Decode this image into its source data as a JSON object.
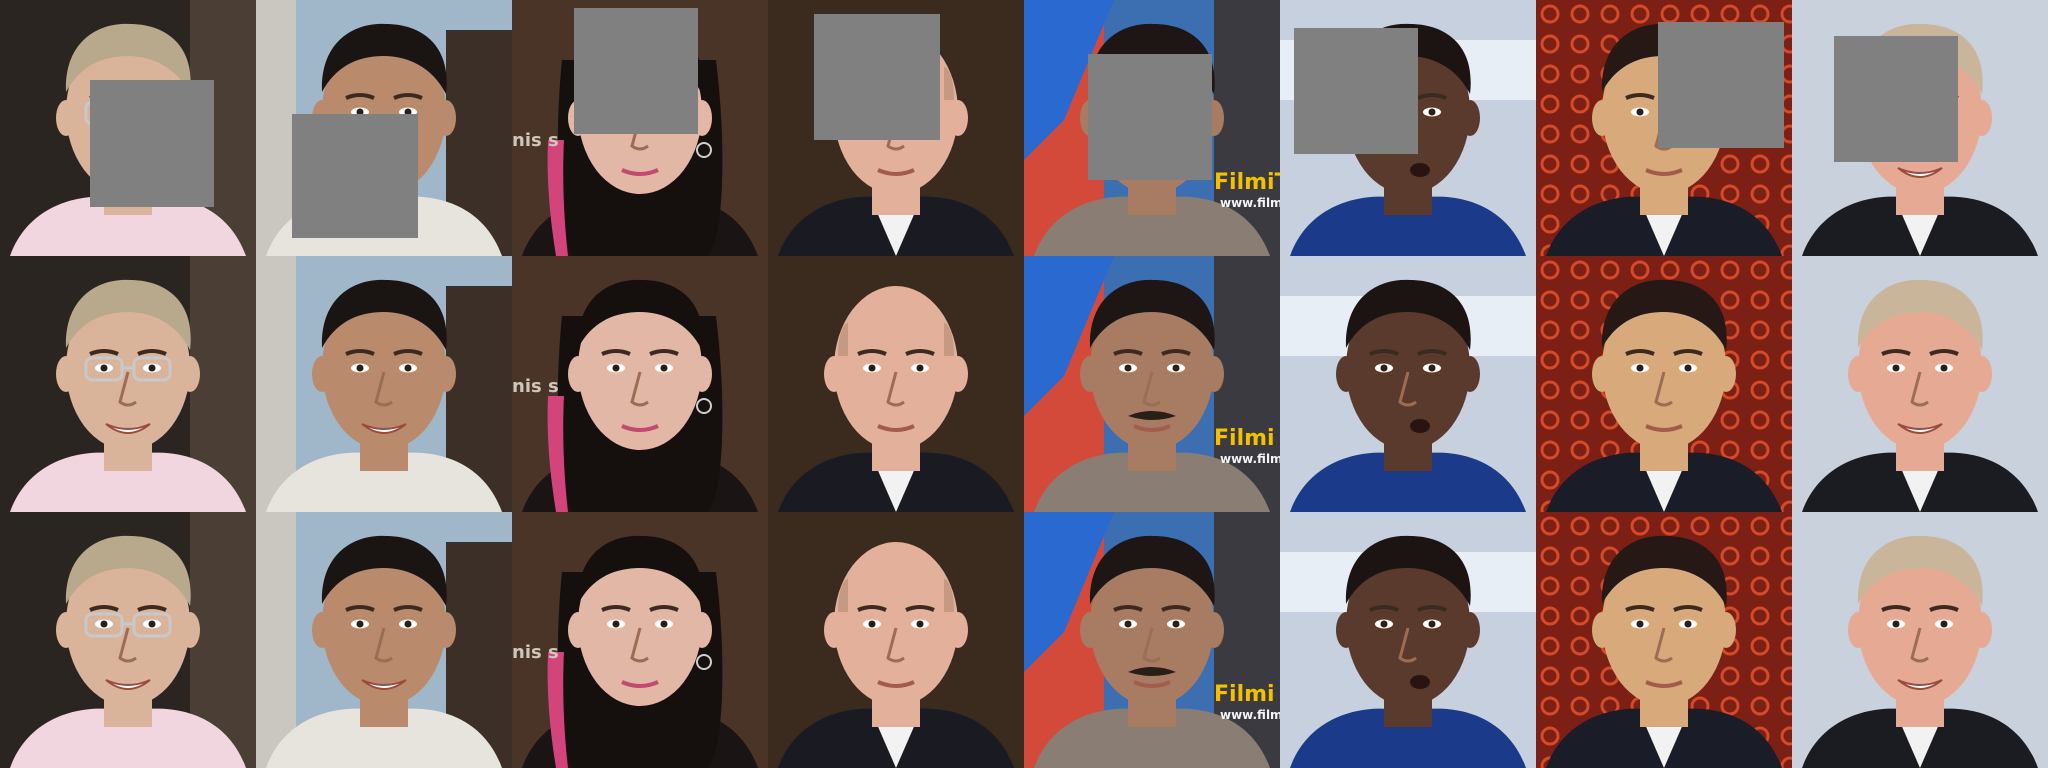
{
  "layout": {
    "columns": 8,
    "rows": 3,
    "row_roles": [
      "masked-input",
      "reconstruction",
      "ground-truth"
    ]
  },
  "subjects": [
    {
      "id": 1,
      "description": "older man with glasses, white collar",
      "bg": "#2b2522",
      "skin": "#d9b39a",
      "hair": "#b8a88c",
      "clothing": "#f1d6df",
      "has_glasses": true
    },
    {
      "id": 2,
      "description": "young man with black hair, outdoor",
      "bg": "#9fb7c8",
      "skin": "#b98a6c",
      "hair": "#1a1412",
      "clothing": "#e7e4de",
      "has_glasses": false
    },
    {
      "id": 3,
      "description": "woman with long dark hair and pink streak, earrings",
      "bg": "#4a3428",
      "skin": "#e2b7a6",
      "hair": "#150f0e",
      "clothing": "#1a1414",
      "has_glasses": false
    },
    {
      "id": 4,
      "description": "bald man in suit",
      "bg": "#3b2a1e",
      "skin": "#e3b19b",
      "hair": "#c59a82",
      "clothing": "#1a1b22",
      "has_glasses": false
    },
    {
      "id": 5,
      "description": "man with mustache, stubble",
      "bg": "#3c6fb1",
      "skin": "#a87b63",
      "hair": "#1d1614",
      "clothing": "#8a7e74",
      "has_glasses": false
    },
    {
      "id": 6,
      "description": "basketball player, short hair",
      "bg": "#c6d0de",
      "skin": "#5a3a2c",
      "hair": "#1b1412",
      "clothing": "#1b3a8a",
      "has_glasses": false
    },
    {
      "id": 7,
      "description": "man with dark hair against red patterned background",
      "bg": "#7c1f14",
      "skin": "#d8a97b",
      "hair": "#261814",
      "clothing": "#1a1c28",
      "has_glasses": false
    },
    {
      "id": 8,
      "description": "smiling older man with light hair",
      "bg": "#c9d1dc",
      "skin": "#e6aa94",
      "hair": "#c9b59a",
      "clothing": "#1b1c22",
      "has_glasses": false
    }
  ],
  "masks": [
    {
      "column": 1
    },
    {
      "column": 2
    },
    {
      "column": 3
    },
    {
      "column": 4
    },
    {
      "column": 5
    },
    {
      "column": 6
    },
    {
      "column": 7
    },
    {
      "column": 8
    }
  ],
  "overlays": {
    "col3_text": "nis s",
    "col5_brand": "FilmiTo",
    "col5_brand_full": "Filmi",
    "col5_url": "www.filmit",
    "col5_brand_top_partial": "FilmiTo"
  },
  "colors": {
    "mask": "#808080",
    "brand_yellow": "#f2c200"
  }
}
